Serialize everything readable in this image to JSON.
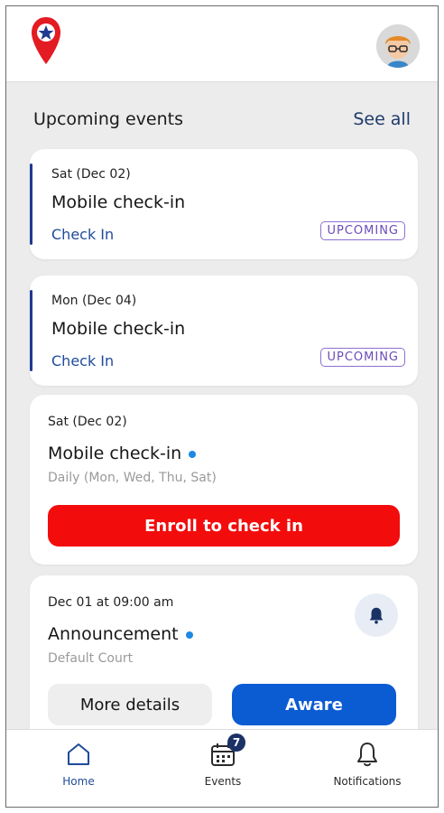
{
  "header": {
    "logo_icon": "map-pin-star-logo",
    "avatar_icon": "user-avatar"
  },
  "section": {
    "title": "Upcoming events",
    "see_all": "See all"
  },
  "cards": [
    {
      "date": "Sat (Dec 02)",
      "title": "Mobile check-in",
      "link": "Check In",
      "badge": "UPCOMING"
    },
    {
      "date": "Mon (Dec 04)",
      "title": "Mobile check-in",
      "link": "Check In",
      "badge": "UPCOMING"
    }
  ],
  "enroll_card": {
    "date": "Sat (Dec 02)",
    "title": "Mobile check-in",
    "subtitle": "Daily (Mon, Wed, Thu, Sat)",
    "button": "Enroll to check in"
  },
  "announcement_card": {
    "date": "Dec 01 at 09:00 am",
    "title": "Announcement",
    "subtitle": "Default Court",
    "more_details": "More details",
    "aware": "Aware"
  },
  "nav": {
    "home": "Home",
    "events": "Events",
    "events_count": "7",
    "notifications": "Notifications"
  },
  "colors": {
    "primary_blue": "#0b5bd3",
    "danger_red": "#f30c0c",
    "badge_purple": "#6b4bb8",
    "link_blue": "#1f4b9a"
  }
}
